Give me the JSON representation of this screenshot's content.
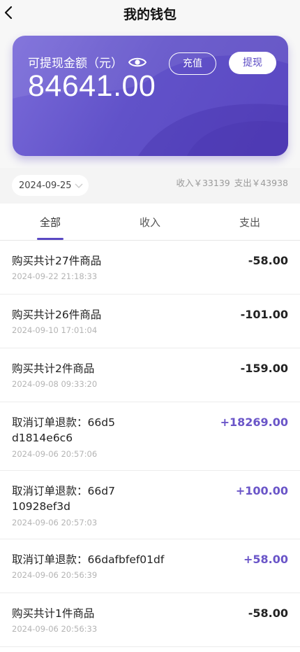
{
  "header": {
    "title": "我的钱包"
  },
  "wallet": {
    "balance_label": "可提现金额（元）",
    "balance": "84641.00",
    "recharge_label": "充值",
    "withdraw_label": "提现"
  },
  "filter": {
    "date": "2024-09-25",
    "income_summary": "收入￥33139",
    "expense_summary": "支出￥43938"
  },
  "tabs": [
    {
      "label": "全部"
    },
    {
      "label": "收入"
    },
    {
      "label": "支出"
    }
  ],
  "transactions": [
    {
      "title": "购买共计27件商品",
      "time": "2024-09-22 21:18:33",
      "amount": "-58.00",
      "type": "expense"
    },
    {
      "title": "购买共计26件商品",
      "time": "2024-09-10 17:01:04",
      "amount": "-101.00",
      "type": "expense"
    },
    {
      "title": "购买共计2件商品",
      "time": "2024-09-08 09:33:20",
      "amount": "-159.00",
      "type": "expense"
    },
    {
      "title": "取消订单退款：66d5d1814e6c6",
      "time": "2024-09-06 20:57:06",
      "amount": "+18269.00",
      "type": "income"
    },
    {
      "title": "取消订单退款：66d710928ef3d",
      "time": "2024-09-06 20:57:03",
      "amount": "+100.00",
      "type": "income"
    },
    {
      "title": "取消订单退款：66dafbfef01df",
      "time": "2024-09-06 20:56:39",
      "amount": "+58.00",
      "type": "income"
    },
    {
      "title": "购买共计1件商品",
      "time": "2024-09-06 20:56:33",
      "amount": "-58.00",
      "type": "expense"
    }
  ],
  "colors": {
    "accent": "#5a49c4",
    "income": "#6a55c8"
  }
}
